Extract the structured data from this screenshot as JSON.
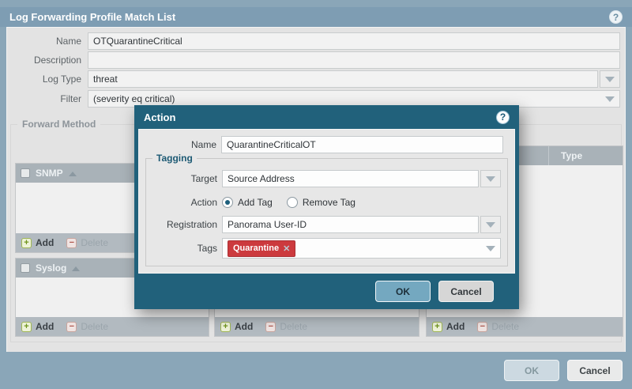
{
  "colors": {
    "chrome_blue": "#7e9db3",
    "dialog_teal": "#21617b",
    "body_gray": "#e3e3e3",
    "tag_red": "#cc3a3e",
    "ok_blue": "#74a8c0"
  },
  "main_dialog": {
    "title": "Log Forwarding Profile Match List",
    "help_icon": "?",
    "fields": {
      "name_label": "Name",
      "name_value": "OTQuarantineCritical",
      "description_label": "Description",
      "description_value": "",
      "log_type_label": "Log Type",
      "log_type_value": "threat",
      "filter_label": "Filter",
      "filter_value": "(severity eq critical)"
    },
    "forward_method": {
      "legend": "Forward Method",
      "snmp_panel": {
        "title": "SNMP",
        "add": "Add",
        "delete": "Delete"
      },
      "syslog_panel": {
        "title": "Syslog",
        "add": "Add",
        "delete": "Delete"
      },
      "middle_panel": {
        "title": "",
        "add": "Add",
        "delete": "Delete"
      },
      "right_panel": {
        "title": "",
        "type_column": "Type",
        "add": "Add",
        "delete": "Delete"
      }
    },
    "footer": {
      "ok": "OK",
      "cancel": "Cancel"
    }
  },
  "action_dialog": {
    "title": "Action",
    "help_icon": "?",
    "name_label": "Name",
    "name_value": "QuarantineCriticalOT",
    "tagging": {
      "legend": "Tagging",
      "target_label": "Target",
      "target_value": "Source Address",
      "action_label": "Action",
      "add_tag_label": "Add Tag",
      "remove_tag_label": "Remove Tag",
      "selected_action": "Add Tag",
      "registration_label": "Registration",
      "registration_value": "Panorama User-ID",
      "tags_label": "Tags",
      "tag_chip": "Quarantine",
      "tag_remove_icon": "✕"
    },
    "footer": {
      "ok": "OK",
      "cancel": "Cancel"
    }
  }
}
